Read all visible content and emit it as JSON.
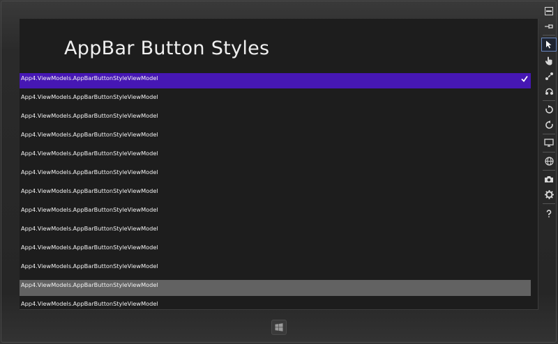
{
  "page": {
    "title": "AppBar Button Styles"
  },
  "list": {
    "items": [
      {
        "label": "App4.ViewModels.AppBarButtonStyleViewModel",
        "state": "selected"
      },
      {
        "label": "App4.ViewModels.AppBarButtonStyleViewModel",
        "state": "normal"
      },
      {
        "label": "App4.ViewModels.AppBarButtonStyleViewModel",
        "state": "normal"
      },
      {
        "label": "App4.ViewModels.AppBarButtonStyleViewModel",
        "state": "normal"
      },
      {
        "label": "App4.ViewModels.AppBarButtonStyleViewModel",
        "state": "normal"
      },
      {
        "label": "App4.ViewModels.AppBarButtonStyleViewModel",
        "state": "normal"
      },
      {
        "label": "App4.ViewModels.AppBarButtonStyleViewModel",
        "state": "normal"
      },
      {
        "label": "App4.ViewModels.AppBarButtonStyleViewModel",
        "state": "normal"
      },
      {
        "label": "App4.ViewModels.AppBarButtonStyleViewModel",
        "state": "normal"
      },
      {
        "label": "App4.ViewModels.AppBarButtonStyleViewModel",
        "state": "normal"
      },
      {
        "label": "App4.ViewModels.AppBarButtonStyleViewModel",
        "state": "normal"
      },
      {
        "label": "App4.ViewModels.AppBarButtonStyleViewModel",
        "state": "hover"
      },
      {
        "label": "App4.ViewModels.AppBarButtonStyleViewModel",
        "state": "normal"
      }
    ]
  },
  "toolbar": {
    "buttons": [
      {
        "icon": "minimize-icon"
      },
      {
        "icon": "pin-icon"
      },
      {
        "icon": "mouse-pointer-icon",
        "active": true
      },
      {
        "icon": "touch-hand-icon"
      },
      {
        "icon": "pinch-zoom-icon"
      },
      {
        "icon": "rotation-touch-icon"
      },
      {
        "icon": "rotate-clockwise-icon"
      },
      {
        "icon": "rotate-counterclockwise-icon"
      },
      {
        "icon": "change-resolution-icon"
      },
      {
        "icon": "set-location-icon"
      },
      {
        "icon": "screenshot-camera-icon"
      },
      {
        "icon": "settings-gear-icon"
      },
      {
        "icon": "help-icon"
      }
    ]
  },
  "colors": {
    "selected_row": "#4617b4",
    "hover_row": "#626262",
    "screen_bg": "#1d1d1d",
    "frame_bg": "#2b2b2b"
  },
  "device": {
    "start_button_icon": "windows-logo-icon"
  }
}
